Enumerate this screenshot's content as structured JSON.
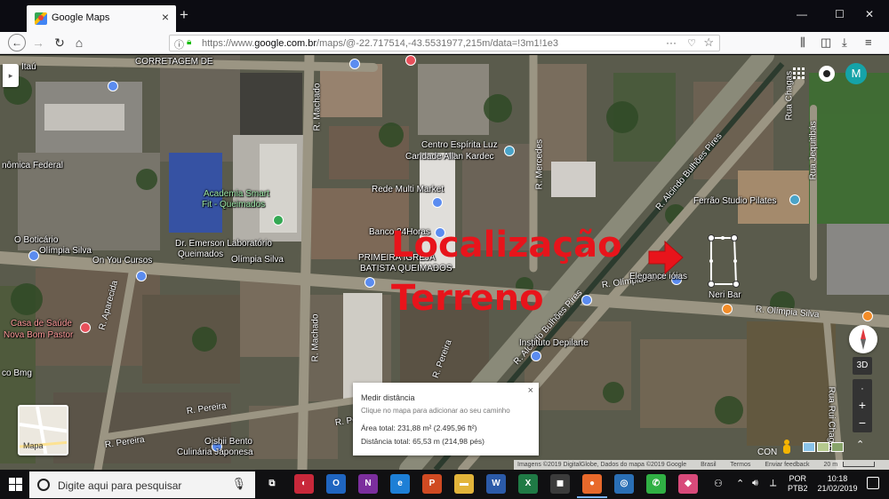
{
  "browser": {
    "tab_title": "Google Maps",
    "tab_close": "×",
    "new_tab": "+",
    "url_prefix": "https://www.",
    "url_domain": "google.com.br",
    "url_rest": "/maps/@-22.717514,-43.5531977,215m/data=!3m1!1e3",
    "window_controls": [
      "—",
      "☐",
      "✕"
    ]
  },
  "map": {
    "overlay_line1": "Localização",
    "overlay_line2": "Terreno",
    "labels": [
      {
        "text": "Itaú",
        "kind": "normal"
      },
      {
        "text": "CORRETAGEM DE",
        "kind": "normal"
      },
      {
        "text": "nômica Federal",
        "kind": "normal"
      },
      {
        "text": "Centro Espírita Luz",
        "kind": "normal"
      },
      {
        "text": "Caridade Allan Kardec",
        "kind": "normal"
      },
      {
        "text": "Academia Smart",
        "kind": "green"
      },
      {
        "text": "Fit - Queimados",
        "kind": "green"
      },
      {
        "text": "Rede Multi Market",
        "kind": "normal"
      },
      {
        "text": "Ferrão Studio Pilates",
        "kind": "normal"
      },
      {
        "text": "O Boticário",
        "kind": "normal"
      },
      {
        "text": "Olímpia Silva",
        "kind": "normal"
      },
      {
        "text": "Dr. Emerson Laboratório",
        "kind": "normal"
      },
      {
        "text": "Queimados",
        "kind": "normal"
      },
      {
        "text": "Olímpia Silva",
        "kind": "normal"
      },
      {
        "text": "Banco 24Horas",
        "kind": "normal"
      },
      {
        "text": "On You Cursos",
        "kind": "normal"
      },
      {
        "text": "PRIMEIRA IGREJA",
        "kind": "normal"
      },
      {
        "text": "BATISTA QUEIMADOS",
        "kind": "normal"
      },
      {
        "text": "Elegance ióias",
        "kind": "normal"
      },
      {
        "text": "Neri Bar",
        "kind": "normal"
      },
      {
        "text": "Casa de Saúde",
        "kind": "red"
      },
      {
        "text": "Nova Bom Pastor",
        "kind": "red"
      },
      {
        "text": "Instituto Depilarte",
        "kind": "normal"
      },
      {
        "text": "co Bmg",
        "kind": "normal"
      },
      {
        "text": "Oishii Bento",
        "kind": "normal"
      },
      {
        "text": "Culinária Japonesa",
        "kind": "normal"
      }
    ],
    "streets": [
      {
        "text": "R. Machado"
      },
      {
        "text": "R. Machado"
      },
      {
        "text": "R. Mercedes"
      },
      {
        "text": "R. Alcindo Bulhões Pires"
      },
      {
        "text": "Rua Jequitibás"
      },
      {
        "text": "R. Olímpia Silva"
      },
      {
        "text": "R. Olímpia Silva"
      },
      {
        "text": "R. Aparecida"
      },
      {
        "text": "R. Pereira"
      },
      {
        "text": "R. Pereira"
      },
      {
        "text": "R. Alcindo Bulhões Pires"
      },
      {
        "text": "Rua Chagas"
      },
      {
        "text": "Rua Rui Chagas"
      },
      {
        "text": "R. Pereira"
      },
      {
        "text": "R. Pereira"
      }
    ],
    "avatar_letter": "M",
    "layer_label": "Mapa",
    "sidebar_toggle": "▸",
    "btn_3d": "3D",
    "zoom_in": "+",
    "zoom_out": "−",
    "con_text": "CON",
    "measure": {
      "title": "Medir distância",
      "hint": "Clique no mapa para adicionar ao seu caminho",
      "area": "Área total: 231,88 m² (2.495,96 ft²)",
      "distance": "Distância total: 65,53 m (214,98 pés)",
      "close": "×"
    },
    "attribution": [
      "Imagens ©2019 DigitalGlobe, Dados do mapa ©2019 Google",
      "Brasil",
      "Termos",
      "Enviar feedback",
      "20 m"
    ]
  },
  "taskbar": {
    "search_placeholder": "Digite aqui para pesquisar",
    "lang_line1": "POR",
    "lang_line2": "PTB2",
    "time": "10:18",
    "date": "21/02/2019",
    "apps": [
      {
        "name": "task-view",
        "label": "⧉",
        "color": "#101012"
      },
      {
        "name": "app-red",
        "label": "◐",
        "color": "#c8283a"
      },
      {
        "name": "outlook",
        "label": "O",
        "color": "#1f65c0"
      },
      {
        "name": "onenote",
        "label": "N",
        "color": "#7b2e9d"
      },
      {
        "name": "edge",
        "label": "e",
        "color": "#1d7fd6"
      },
      {
        "name": "powerpoint",
        "label": "P",
        "color": "#d04a22"
      },
      {
        "name": "explorer",
        "label": "▬",
        "color": "#e2b43a"
      },
      {
        "name": "word",
        "label": "W",
        "color": "#2b5aa8"
      },
      {
        "name": "excel",
        "label": "X",
        "color": "#1f7a45"
      },
      {
        "name": "store",
        "label": "◼",
        "color": "#3b3b3b"
      },
      {
        "name": "firefox",
        "label": "●",
        "color": "#e8692b"
      },
      {
        "name": "app-ring",
        "label": "◎",
        "color": "#2a6fb5"
      },
      {
        "name": "whatsapp",
        "label": "✆",
        "color": "#30b044"
      },
      {
        "name": "maps-app",
        "label": "◆",
        "color": "#d84a7a"
      }
    ]
  }
}
